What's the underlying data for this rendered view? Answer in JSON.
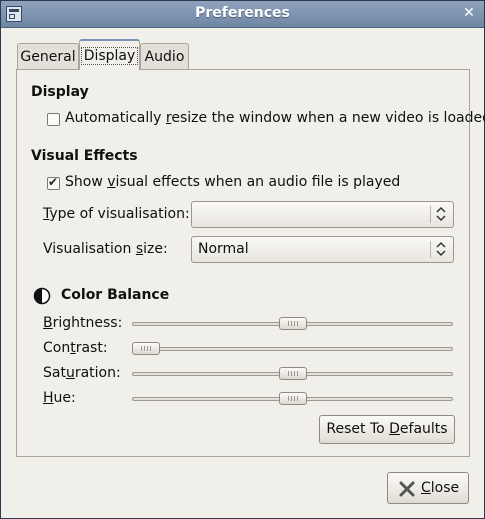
{
  "window": {
    "title": "Preferences"
  },
  "tabs": [
    {
      "label": "General",
      "active": false
    },
    {
      "label": "Display",
      "active": true
    },
    {
      "label": "Audio",
      "active": false
    }
  ],
  "display": {
    "heading": "Display",
    "auto_resize": {
      "label_pre": "Automatically ",
      "label_mn": "r",
      "label_post": "esize the window when a new video is loaded",
      "checked": false
    }
  },
  "visual_effects": {
    "heading": "Visual Effects",
    "show_effects": {
      "label_pre": "Show ",
      "label_mn": "v",
      "label_post": "isual effects when an audio file is played",
      "checked": true
    },
    "type": {
      "label_pre": "",
      "label_mn": "T",
      "label_post": "ype of visualisation:",
      "value": ""
    },
    "size": {
      "label_pre": "Visualisation ",
      "label_mn": "s",
      "label_post": "ize:",
      "value": "Normal"
    }
  },
  "color_balance": {
    "heading": "Color Balance",
    "icon": "contrast-icon",
    "sliders": [
      {
        "name": "brightness",
        "label_pre": "",
        "label_mn": "B",
        "label_post": "rightness:",
        "value": 0.5
      },
      {
        "name": "contrast",
        "label_pre": "Con",
        "label_mn": "t",
        "label_post": "rast:",
        "value": 0.0
      },
      {
        "name": "saturation",
        "label_pre": "Sat",
        "label_mn": "u",
        "label_post": "ration:",
        "value": 0.5
      },
      {
        "name": "hue",
        "label_pre": "",
        "label_mn": "H",
        "label_post": "ue:",
        "value": 0.5
      }
    ],
    "reset": {
      "label_pre": "Reset To ",
      "label_mn": "D",
      "label_post": "efaults"
    }
  },
  "footer": {
    "close": {
      "label_pre": "",
      "label_mn": "C",
      "label_post": "lose",
      "icon": "close-x-icon"
    }
  }
}
